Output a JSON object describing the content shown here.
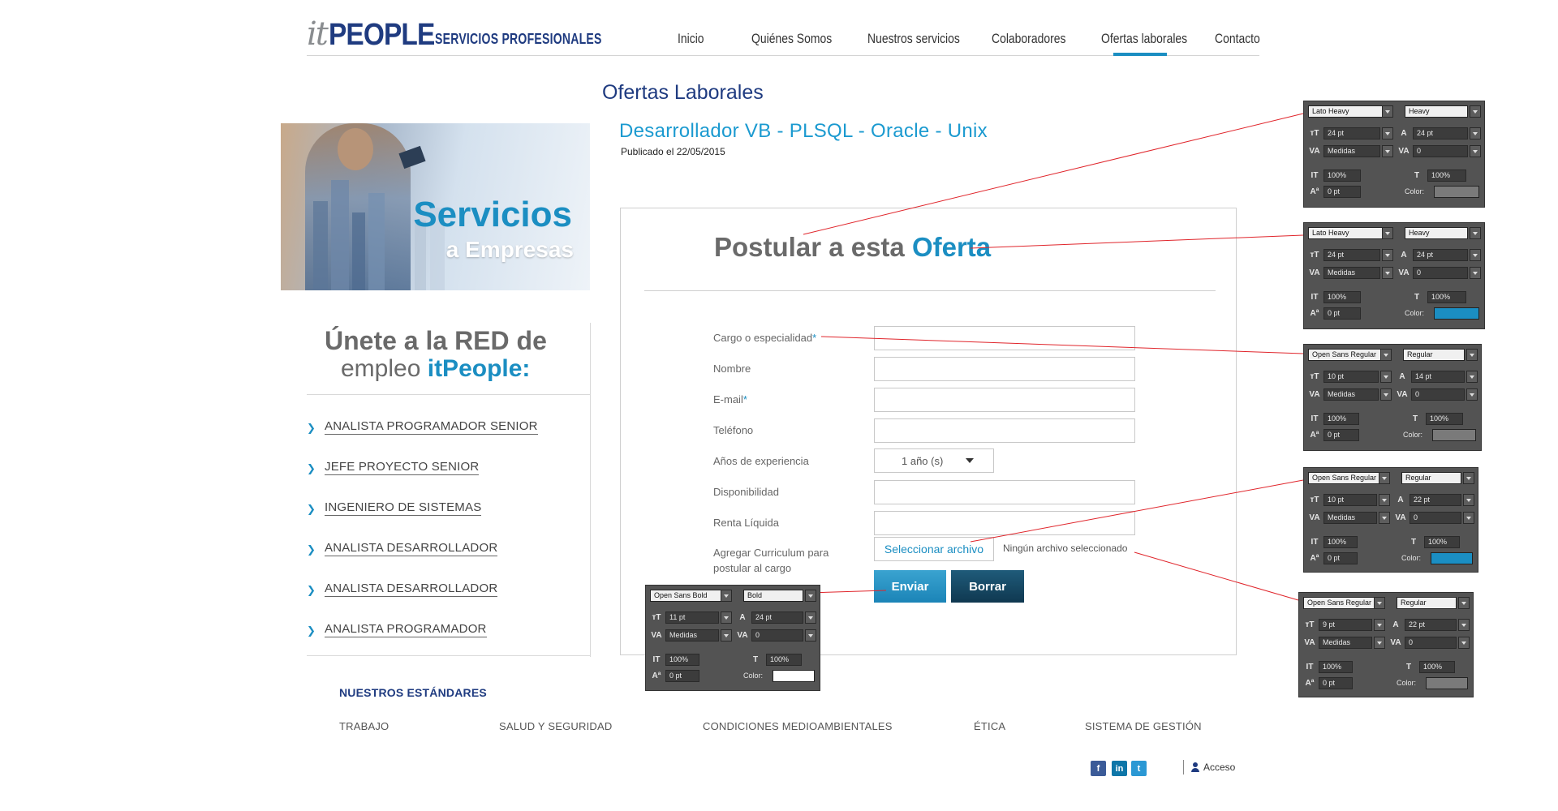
{
  "header": {
    "logo_it": "it",
    "logo_people": "PEOPLE",
    "logo_sub": "SERVICIOS PROFESIONALES",
    "nav": [
      {
        "label": "Inicio"
      },
      {
        "label": "Quiénes Somos"
      },
      {
        "label": "Nuestros servicios"
      },
      {
        "label": "Colaboradores"
      },
      {
        "label": "Ofertas laborales",
        "active": true
      },
      {
        "label": "Contacto"
      }
    ]
  },
  "page": {
    "title": "Ofertas Laborales",
    "job_title": "Desarrollador VB - PLSQL - Oracle - Unix",
    "published": "Publicado el 22/05/2015"
  },
  "banner": {
    "title": "Servicios",
    "subtitle": "a Empresas"
  },
  "sidebar": {
    "join_line1": "Únete a la RED de",
    "join_line2_a": "empleo ",
    "join_line2_b": "itPeople:",
    "jobs": [
      {
        "label": "ANALISTA PROGRAMADOR SENIOR"
      },
      {
        "label": "JEFE PROYECTO SENIOR"
      },
      {
        "label": "INGENIERO DE SISTEMAS"
      },
      {
        "label": "ANALISTA DESARROLLADOR"
      },
      {
        "label": "ANALISTA DESARROLLADOR"
      },
      {
        "label": "ANALISTA PROGRAMADOR"
      }
    ]
  },
  "form": {
    "title_a": "Postular a esta ",
    "title_b": "Oferta",
    "fields": [
      {
        "label": "Cargo o especialidad",
        "required": "*",
        "value": ""
      },
      {
        "label": "Nombre",
        "required": "",
        "value": ""
      },
      {
        "label": "E-mail",
        "required": "*",
        "value": ""
      },
      {
        "label": "Teléfono",
        "required": "",
        "value": ""
      },
      {
        "label": "Años de experiencia",
        "required": "",
        "value": "1 año (s)"
      },
      {
        "label": "Disponibilidad",
        "required": "",
        "value": ""
      },
      {
        "label": "Renta Líquida",
        "required": "",
        "value": ""
      }
    ],
    "cv_label_1": "Agregar Curriculum para",
    "cv_label_2": "postular al cargo",
    "file_button": "Seleccionar archivo",
    "file_none": "Ningún archivo seleccionado",
    "send": "Enviar",
    "clear": "Borrar"
  },
  "footer": {
    "standards_title": "NUESTROS ESTÁNDARES",
    "standards": [
      {
        "label": "TRABAJO"
      },
      {
        "label": "SALUD Y SEGURIDAD"
      },
      {
        "label": "CONDICIONES MEDIOAMBIENTALES"
      },
      {
        "label": "ÉTICA"
      },
      {
        "label": "SISTEMA DE GESTIÓN"
      }
    ],
    "social": [
      {
        "icon": "facebook-icon",
        "glyph": "f"
      },
      {
        "icon": "linkedin-icon",
        "glyph": "in"
      },
      {
        "icon": "twitter-icon",
        "glyph": "t"
      }
    ],
    "access": "Acceso"
  },
  "annotations": [
    {
      "font": "Lato Heavy",
      "style": "Heavy",
      "size": "24 pt",
      "leading": "24 pt",
      "kerning": "Medidas",
      "tracking": "0",
      "vscale": "100%",
      "hscale": "100%",
      "baseline": "0 pt",
      "color_label": "Color:",
      "color": "#7a7a7a"
    },
    {
      "font": "Lato Heavy",
      "style": "Heavy",
      "size": "24 pt",
      "leading": "24 pt",
      "kerning": "Medidas",
      "tracking": "0",
      "vscale": "100%",
      "hscale": "100%",
      "baseline": "0 pt",
      "color_label": "Color:",
      "color": "#1b8ec2"
    },
    {
      "font": "Open Sans Regular",
      "style": "Regular",
      "size": "10 pt",
      "leading": "14 pt",
      "kerning": "Medidas",
      "tracking": "0",
      "vscale": "100%",
      "hscale": "100%",
      "baseline": "0 pt",
      "color_label": "Color:",
      "color": "#7a7a7a"
    },
    {
      "font": "Open Sans Regular",
      "style": "Regular",
      "size": "10 pt",
      "leading": "22 pt",
      "kerning": "Medidas",
      "tracking": "0",
      "vscale": "100%",
      "hscale": "100%",
      "baseline": "0 pt",
      "color_label": "Color:",
      "color": "#1b8ec2"
    },
    {
      "font": "Open Sans Regular",
      "style": "Regular",
      "size": "9 pt",
      "leading": "22 pt",
      "kerning": "Medidas",
      "tracking": "0",
      "vscale": "100%",
      "hscale": "100%",
      "baseline": "0 pt",
      "color_label": "Color:",
      "color": "#7a7a7a"
    },
    {
      "font": "Open Sans Bold",
      "style": "Bold",
      "size": "11 pt",
      "leading": "24 pt",
      "kerning": "Medidas",
      "tracking": "0",
      "vscale": "100%",
      "hscale": "100%",
      "baseline": "0 pt",
      "color_label": "Color:",
      "color": "#ffffff"
    }
  ],
  "colors": {
    "brand_navy": "#1f3b80",
    "accent_blue": "#1b8ec2",
    "annotation_line": "#e0252b"
  }
}
